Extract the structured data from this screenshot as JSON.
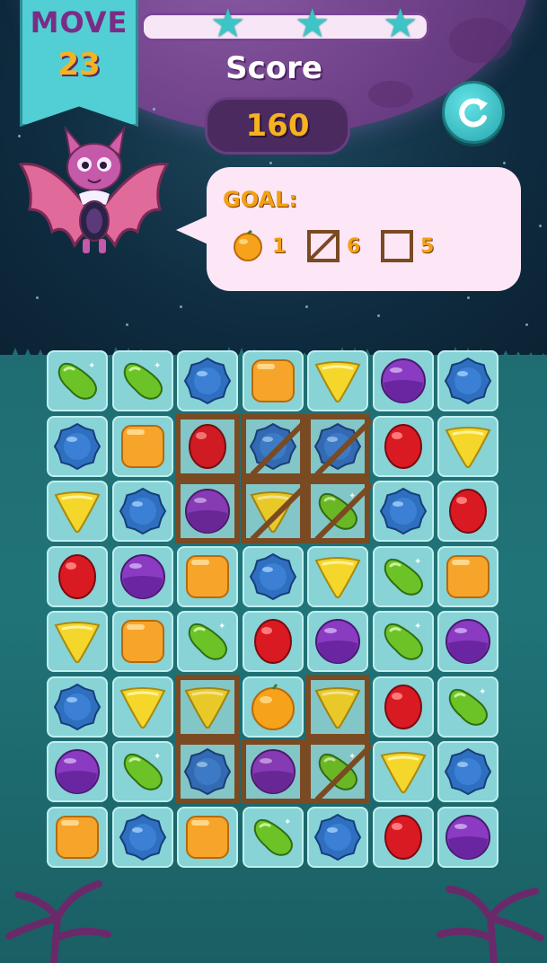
{
  "hud": {
    "move_label": "MOVE",
    "move_value": "23",
    "score_label": "Score",
    "score_value": "160",
    "progress_stars": 3
  },
  "goal": {
    "label": "GOAL:",
    "items": [
      {
        "icon": "orange-icon",
        "count": "1"
      },
      {
        "icon": "crate-icon",
        "count": "6"
      },
      {
        "icon": "empty-box-icon",
        "count": "5"
      }
    ]
  },
  "colors": {
    "teal": "#52cfd4",
    "purple": "#7a2d85",
    "gold": "#f6b21f",
    "cell": "#87d3d6",
    "crate": "#7a4a22"
  },
  "board": {
    "cols": 7,
    "rows": 8,
    "grid": [
      [
        "green-jelly",
        "green-jelly",
        "blue-gem",
        "orange-square",
        "yellow-triangle",
        "purple-ball",
        "blue-gem"
      ],
      [
        "blue-gem",
        "orange-square",
        "red-oval",
        "blue-gem",
        "blue-gem",
        "red-oval",
        "yellow-triangle"
      ],
      [
        "yellow-triangle",
        "blue-gem",
        "purple-ball",
        "yellow-triangle",
        "green-jelly",
        "blue-gem",
        "red-oval"
      ],
      [
        "red-oval",
        "purple-ball",
        "orange-square",
        "blue-gem",
        "yellow-triangle",
        "green-jelly",
        "orange-square"
      ],
      [
        "yellow-triangle",
        "orange-square",
        "green-jelly",
        "red-oval",
        "purple-ball",
        "green-jelly",
        "purple-ball"
      ],
      [
        "blue-gem",
        "yellow-triangle",
        "yellow-triangle",
        "orange-fruit",
        "yellow-triangle",
        "red-oval",
        "green-jelly"
      ],
      [
        "purple-ball",
        "green-jelly",
        "blue-gem",
        "purple-ball",
        "green-jelly",
        "yellow-triangle",
        "blue-gem"
      ],
      [
        "orange-square",
        "blue-gem",
        "orange-square",
        "green-jelly",
        "blue-gem",
        "red-oval",
        "purple-ball"
      ]
    ],
    "crates": [
      {
        "row": 1,
        "col": 2,
        "slat": false
      },
      {
        "row": 1,
        "col": 3,
        "slat": true
      },
      {
        "row": 1,
        "col": 4,
        "slat": true
      },
      {
        "row": 2,
        "col": 2,
        "slat": false
      },
      {
        "row": 2,
        "col": 3,
        "slat": true
      },
      {
        "row": 2,
        "col": 4,
        "slat": true
      },
      {
        "row": 5,
        "col": 2,
        "slat": false
      },
      {
        "row": 5,
        "col": 4,
        "slat": false
      },
      {
        "row": 6,
        "col": 2,
        "slat": false
      },
      {
        "row": 6,
        "col": 3,
        "slat": false
      },
      {
        "row": 6,
        "col": 4,
        "slat": true
      }
    ]
  }
}
